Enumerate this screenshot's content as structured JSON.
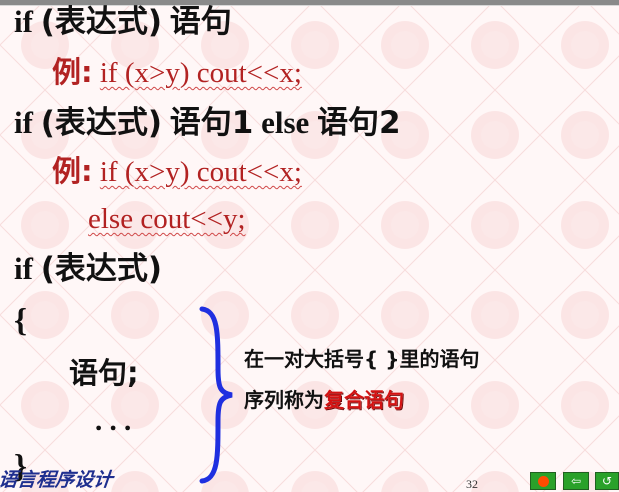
{
  "slide": {
    "line1_keyword": "if",
    "line1_cond": "(表达式)",
    "line1_stmt": "语句",
    "line2_label": "例:",
    "line2_code": "if (x>y) cout<<x;",
    "line3_keyword": "if",
    "line3_cond": "(表达式)",
    "line3_stmt1": "语句1",
    "line3_else": "else",
    "line3_stmt2": "语句2",
    "line4_label": "例:",
    "line4_code": "if (x>y) cout<<x;",
    "line5_code": "else cout<<y;",
    "line6_keyword": "if",
    "line6_cond": "(表达式)",
    "open_brace": "{",
    "statement": "语句;",
    "ellipsis": ". . .",
    "close_brace": "}",
    "note_line1": "在一对大括号{ }里的语句",
    "note_line2_prefix": "序列称为",
    "note_line2_highlight": "复合语句"
  },
  "footer": {
    "title": "语言程序设计",
    "page_number": "32"
  },
  "nav": {
    "back_label": "⇦",
    "return_label": "↺"
  },
  "colors": {
    "example_red": "#b22222",
    "highlight_red": "#d31212",
    "brace_blue": "#1f2fe0",
    "footer_blue": "#1f2f8f",
    "nav_green": "#2aa12a"
  }
}
